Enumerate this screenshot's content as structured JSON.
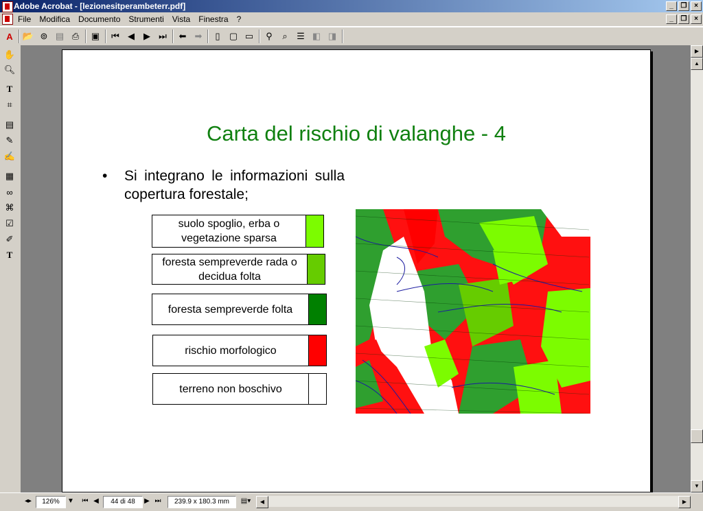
{
  "window": {
    "title": "Adobe Acrobat - [lezionesitperambeterr.pdf]"
  },
  "menu": {
    "items": [
      "File",
      "Modifica",
      "Documento",
      "Strumenti",
      "Vista",
      "Finestra",
      "?"
    ]
  },
  "slide": {
    "title": "Carta del rischio di valanghe - 4",
    "bullet_mark": "•",
    "bullet_text": "Si integrano le informazioni sulla copertura forestale;",
    "legend": [
      {
        "label": "suolo spoglio, erba o vegetazione sparsa",
        "color": "#7cfc00"
      },
      {
        "label": "foresta sempreverde rada o decidua folta",
        "color": "#66cc00"
      },
      {
        "label": "foresta sempreverde folta",
        "color": "#008000"
      },
      {
        "label": "rischio morfologico",
        "color": "#ff0000"
      },
      {
        "label": "terreno non boschivo",
        "color": "#ffffff"
      }
    ]
  },
  "status": {
    "zoom": "126%",
    "page": "44 di 48",
    "page_size": "239.9 x 180.3 mm"
  },
  "icons": {
    "toolbar": [
      "open-icon",
      "acrobat-icon",
      "save-icon",
      "print-icon",
      "thumbnails-icon",
      "first-page-icon",
      "prev-page-icon",
      "next-page-icon",
      "last-page-icon",
      "go-back-icon",
      "go-forward-icon",
      "actual-size-icon",
      "fit-page-icon",
      "fit-width-icon",
      "find-icon",
      "search-icon",
      "search-results-icon",
      "prev-highlight-icon",
      "next-highlight-icon"
    ],
    "left": [
      "hand-icon",
      "zoom-icon",
      "text-select-icon",
      "crop-icon",
      "note-icon",
      "pencil-icon",
      "highlight-icon",
      "movie-icon",
      "link-icon",
      "article-icon",
      "form-icon",
      "touchup-icon",
      "touchup-text-icon"
    ]
  },
  "colors": {
    "title": "#108010",
    "titlebar_start": "#0a246a",
    "titlebar_end": "#a6caf0"
  }
}
